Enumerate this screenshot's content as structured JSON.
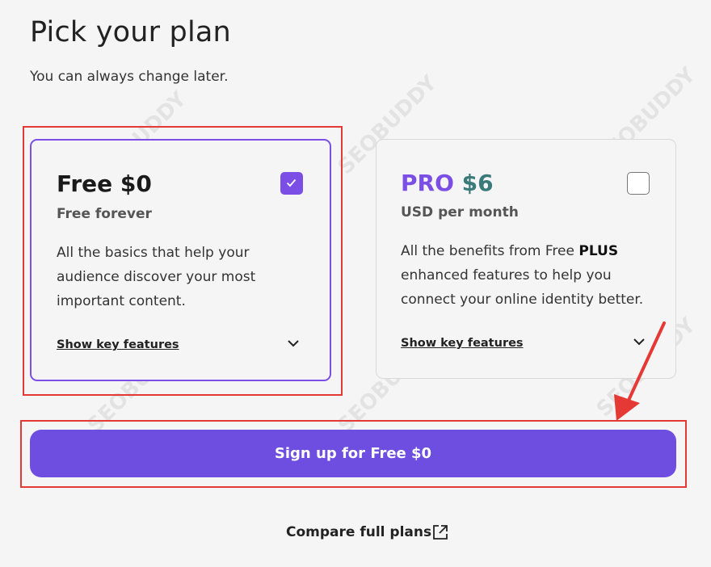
{
  "header": {
    "title": "Pick your plan",
    "subtitle": "You can always change later."
  },
  "plans": [
    {
      "name": "Free $0",
      "subtitle": "Free forever",
      "description": "All the basics that help your audience discover your most important content.",
      "features_link": "Show key features",
      "selected": true
    },
    {
      "name_prefix": "PRO",
      "price": "$6",
      "subtitle": "USD per month",
      "description_before": "All the benefits from Free ",
      "description_bold": "PLUS",
      "description_after": " enhanced features to help you connect your online identity better.",
      "features_link": "Show key features",
      "selected": false
    }
  ],
  "signup_button": "Sign up for Free $0",
  "compare_link": "Compare full plans",
  "watermark": "SEOBUDDY",
  "colors": {
    "accent": "#7b4ee6",
    "button": "#6e4ee0",
    "pro_name": "#7b4ee6",
    "pro_price": "#3a7a7a",
    "highlight": "#e53935"
  }
}
